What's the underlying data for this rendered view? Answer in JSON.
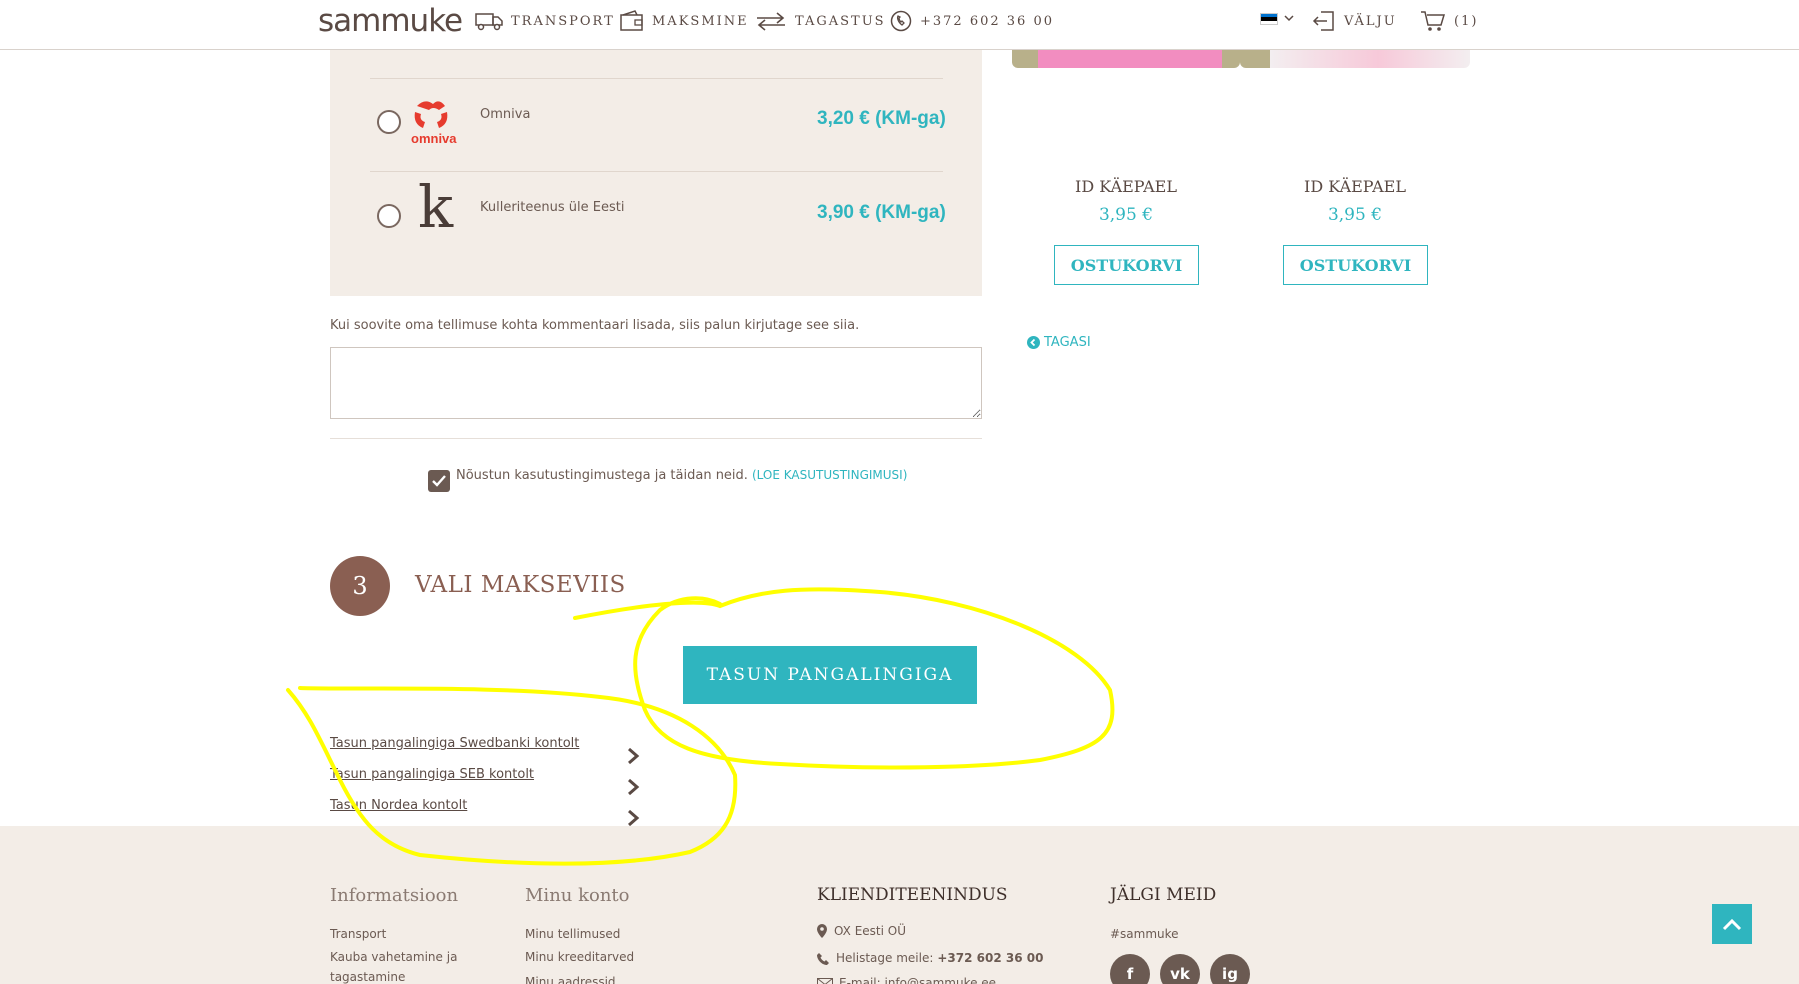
{
  "header": {
    "logo": "sammuke",
    "nav": [
      {
        "label": "TRANSPORT",
        "icon": "truck-icon"
      },
      {
        "label": "MAKSMINE",
        "icon": "wallet-icon"
      },
      {
        "label": "TAGASTUS",
        "icon": "return-arrows-icon"
      },
      {
        "label": "+372 602 36 00",
        "icon": "phone-icon"
      }
    ],
    "logout": "VÄLJU",
    "cart_count": "(1)"
  },
  "shipping": {
    "options": [
      {
        "name": "Omniva",
        "logo_text": "omniva",
        "price": "3,20 € (KM-ga)"
      },
      {
        "name": "Kulleriteenus üle Eesti",
        "logo_text": "k",
        "price": "3,90 € (KM-ga)"
      }
    ]
  },
  "comment": {
    "label": "Kui soovite oma tellimuse kohta kommentaari lisada, siis palun kirjutage see siia."
  },
  "terms": {
    "text": "Nõustun kasutustingimustega ja täidan neid.",
    "link": "(LOE KASUTUSTINGIMUSI)"
  },
  "payment": {
    "step_number": "3",
    "title": "VALI MAKSEVIIS",
    "button": "TASUN PANGALINGIGA",
    "banks": [
      "Tasun pangalingiga Swedbanki kontolt",
      "Tasun pangalingiga SEB kontolt",
      "Tasun Nordea kontolt"
    ]
  },
  "products": [
    {
      "name": "ID KÄEPAEL",
      "price": "3,95 €",
      "button": "OSTUKORVI"
    },
    {
      "name": "ID KÄEPAEL",
      "price": "3,95 €",
      "button": "OSTUKORVI"
    }
  ],
  "back": "TAGASI",
  "footer": {
    "info": {
      "title": "Informatsioon",
      "links": [
        "Transport",
        "Kauba vahetamine ja",
        "tagastamine"
      ]
    },
    "account": {
      "title": "Minu konto",
      "links": [
        "Minu tellimused",
        "Minu kreeditarved",
        "Minu aadressid"
      ]
    },
    "support": {
      "title": "KLIENDITEENINDUS",
      "company": "OX Eesti OÜ",
      "phone_label": "Helistage meile:",
      "phone": "+372 602 36 00",
      "email": "E-mail: info@sammuke.ee"
    },
    "follow": {
      "title": "JÄLGI MEID",
      "hashtag": "#sammuke",
      "socials": [
        "f",
        "vk",
        "ig"
      ]
    }
  },
  "colors": {
    "accent": "#2fb5bf",
    "brown": "#8a5f52",
    "panel": "#f3ede7",
    "annotation": "#ffff00"
  }
}
